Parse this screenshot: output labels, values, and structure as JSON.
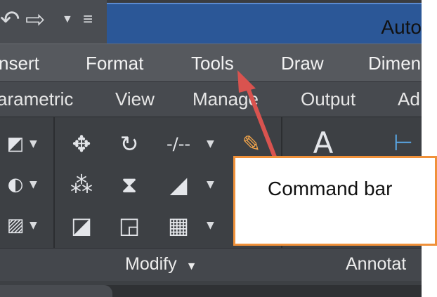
{
  "titlebar": {
    "title_partial": "Auto",
    "qat_icons": [
      "undo-icon",
      "redo-icon",
      "dropdown-icon",
      "customize-menu-icon"
    ]
  },
  "menubar": {
    "items": [
      {
        "label": "nsert"
      },
      {
        "label": "Format"
      },
      {
        "label": "Tools"
      },
      {
        "label": "Draw"
      },
      {
        "label": "Dimen"
      }
    ]
  },
  "ribbon_tabs": {
    "items": [
      {
        "label": "arametric"
      },
      {
        "label": "View"
      },
      {
        "label": "Manage"
      },
      {
        "label": "Output"
      },
      {
        "label": "Ad"
      }
    ]
  },
  "ribbon_panel": {
    "modify_label": "Modify",
    "annotate_label": "Annotat",
    "icons": [
      "move-icon",
      "rotate-icon",
      "trim-icon",
      "copy-icon",
      "mirror-icon",
      "fillet-icon",
      "stretch-icon",
      "scale-icon",
      "array-icon",
      "pencil-icon",
      "text-icon",
      "linear-dimension-icon"
    ]
  },
  "callout": {
    "text": "Command bar",
    "border_color": "#f0913a",
    "arrow_color": "#d9534f"
  },
  "colors": {
    "title_blue": "#2b5797",
    "dark_ui": "#3f4246"
  }
}
